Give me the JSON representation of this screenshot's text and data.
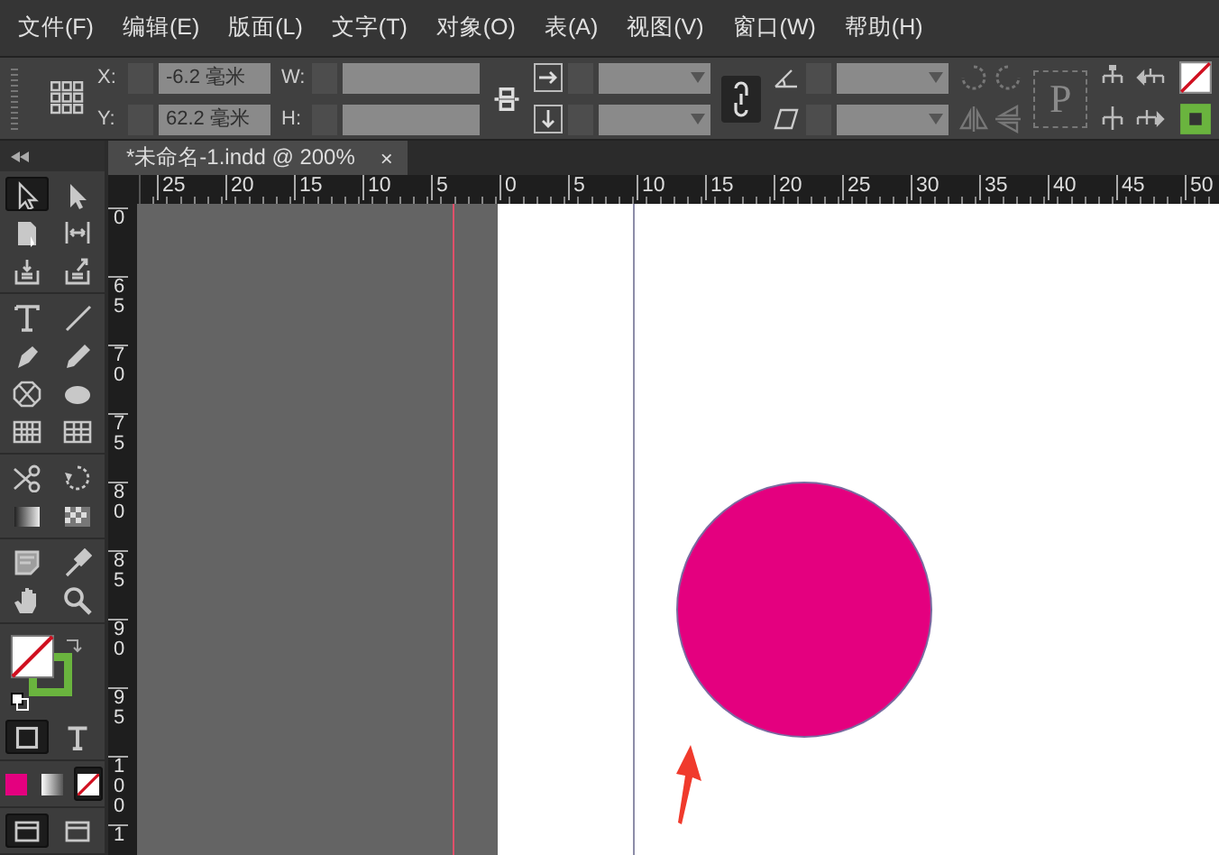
{
  "menu": [
    {
      "label": "文件(F)"
    },
    {
      "label": "编辑(E)"
    },
    {
      "label": "版面(L)"
    },
    {
      "label": "文字(T)"
    },
    {
      "label": "对象(O)"
    },
    {
      "label": "表(A)"
    },
    {
      "label": "视图(V)"
    },
    {
      "label": "窗口(W)"
    },
    {
      "label": "帮助(H)"
    }
  ],
  "control_panel": {
    "x_label": "X:",
    "x_value": "-6.2 毫米",
    "y_label": "Y:",
    "y_value": "62.2 毫米",
    "w_label": "W:",
    "h_label": "H:",
    "frame_glyph": "P"
  },
  "document_tab": {
    "title": "*未命名-1.indd @ 200%",
    "close": "×"
  },
  "horizontal_ruler": [
    "25",
    "20",
    "15",
    "10",
    "5",
    "0",
    "5",
    "10",
    "15",
    "20",
    "25",
    "30",
    "35",
    "40",
    "45",
    "50"
  ],
  "vertical_ruler": [
    "0",
    "65",
    "70",
    "75",
    "80",
    "85",
    "90",
    "95",
    "100",
    "1"
  ],
  "tools": [
    {
      "selected": true
    },
    {
      "selected": false
    },
    {
      "selected": false
    },
    {
      "selected": false
    },
    {
      "selected": false
    },
    {
      "selected": false
    },
    {
      "selected": false
    },
    {
      "selected": false
    },
    {
      "selected": false
    },
    {
      "selected": false
    },
    {
      "selected": false
    },
    {
      "selected": false
    },
    {
      "selected": false
    },
    {
      "selected": false
    },
    {
      "selected": false
    },
    {
      "selected": false
    },
    {
      "selected": false
    },
    {
      "selected": false
    },
    {
      "selected": false
    },
    {
      "selected": false
    },
    {
      "selected": false
    },
    {
      "selected": false
    }
  ],
  "formatting": [
    {
      "selected": true
    },
    {
      "selected": false
    }
  ],
  "apply_modes": [
    {
      "selected": false
    },
    {
      "selected": false
    },
    {
      "selected": true
    }
  ],
  "view_modes": [
    {
      "selected": true
    },
    {
      "selected": false
    }
  ]
}
